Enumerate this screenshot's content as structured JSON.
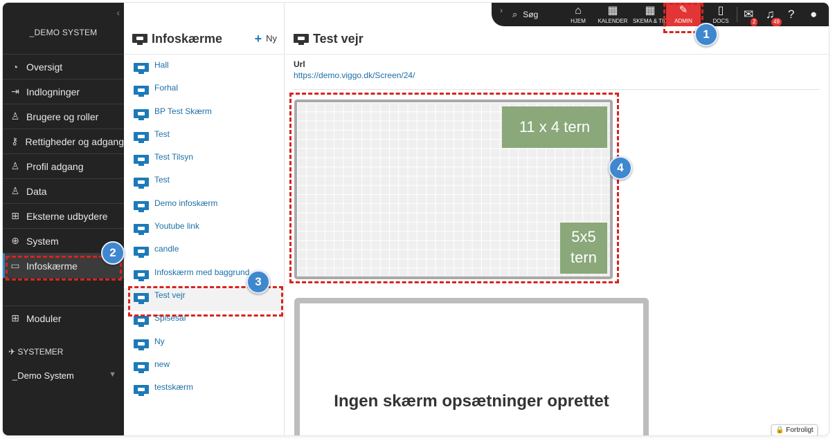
{
  "sidebar": {
    "system_title": "_DEMO SYSTEM",
    "items": [
      {
        "label": "Oversigt",
        "icon": "gauge-icon"
      },
      {
        "label": "Indlogninger",
        "icon": "login-icon"
      },
      {
        "label": "Brugere og roller",
        "icon": "users-icon"
      },
      {
        "label": "Rettigheder og adgang",
        "icon": "key-icon"
      },
      {
        "label": "Profil adgang",
        "icon": "profile-icon"
      },
      {
        "label": "Data",
        "icon": "data-icon"
      },
      {
        "label": "Eksterne udbydere",
        "icon": "external-icon"
      },
      {
        "label": "System",
        "icon": "globe-icon"
      },
      {
        "label": "Infoskærme",
        "icon": "monitor-icon"
      }
    ],
    "modules_label": "Moduler",
    "systemer_label": "SYSTEMER",
    "system_select": "_Demo System"
  },
  "list_panel": {
    "title": "Infoskærme",
    "new_label": "Ny",
    "items": [
      "Hall",
      "Forhal",
      "BP Test Skærm",
      "Test",
      "Test Tilsyn",
      "Test",
      "Demo infoskærm",
      "Youtube link",
      "candle",
      "Infoskærm med baggrund",
      "Test vejr",
      "Spisesal",
      "Ny",
      "new",
      "testskærm"
    ],
    "selected": "Test vejr"
  },
  "topbar": {
    "search_label": "Søg",
    "hjem": "HJEM",
    "kalender": "KALENDER",
    "skema": "SKEMA & TID",
    "admin": "ADMIN",
    "docs": "DOCS",
    "mail_count": "2",
    "notif_count": "49",
    "accent_color": "#e33535"
  },
  "main": {
    "title": "Test vejr",
    "url_label": "Url",
    "url_value": "https://demo.viggo.dk/Screen/24/",
    "tile1": "11 x 4 tern",
    "tile2_line1": "5x5",
    "tile2_line2": "tern",
    "preview_text": "Ingen skærm opsætninger oprettet",
    "confidential": "Fortroligt"
  },
  "callouts": [
    "1",
    "2",
    "3",
    "4"
  ]
}
